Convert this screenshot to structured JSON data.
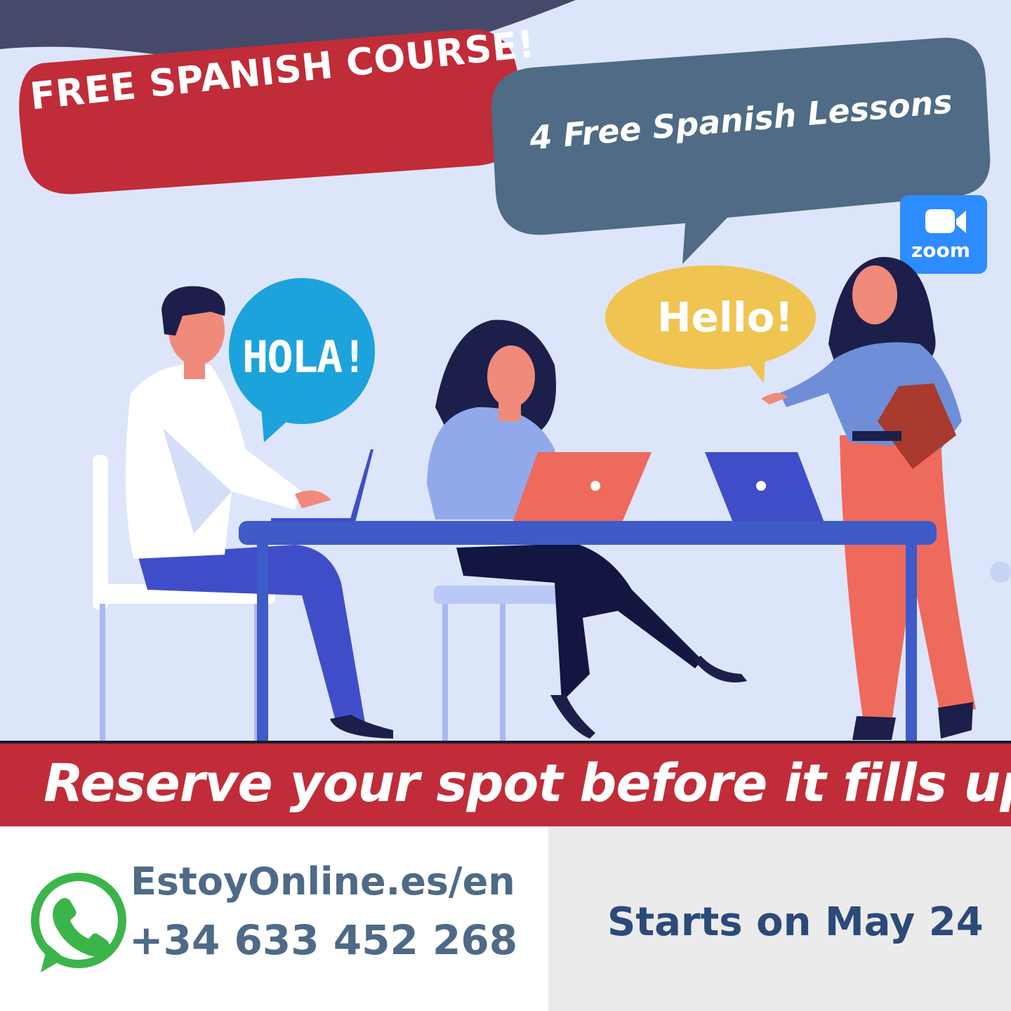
{
  "promo": {
    "headline": "FREE SPANISH COURSE!",
    "subheadline": "4 Free Spanish Lessons",
    "hola_bubble": "HOLA!",
    "hello_bubble": "Hello!",
    "zoom_label": "zoom",
    "banner": "Reserve your spot before it fills up",
    "website": "EstoyOnline.es/en",
    "phone": "+34 633 452 268",
    "start_date": "Starts on May 24"
  },
  "icons": {
    "zoom": "zoom-logo-icon",
    "whatsapp": "whatsapp-icon"
  },
  "colors": {
    "red": "#c02c38",
    "slate": "#4f6b86",
    "zoom_blue": "#2d8cff",
    "hola_blue": "#1ca3dc",
    "hello_yellow": "#f0c450",
    "whatsapp_green": "#3bb54a",
    "text_blue": "#4e6a87",
    "date_blue": "#2b4a7a"
  }
}
